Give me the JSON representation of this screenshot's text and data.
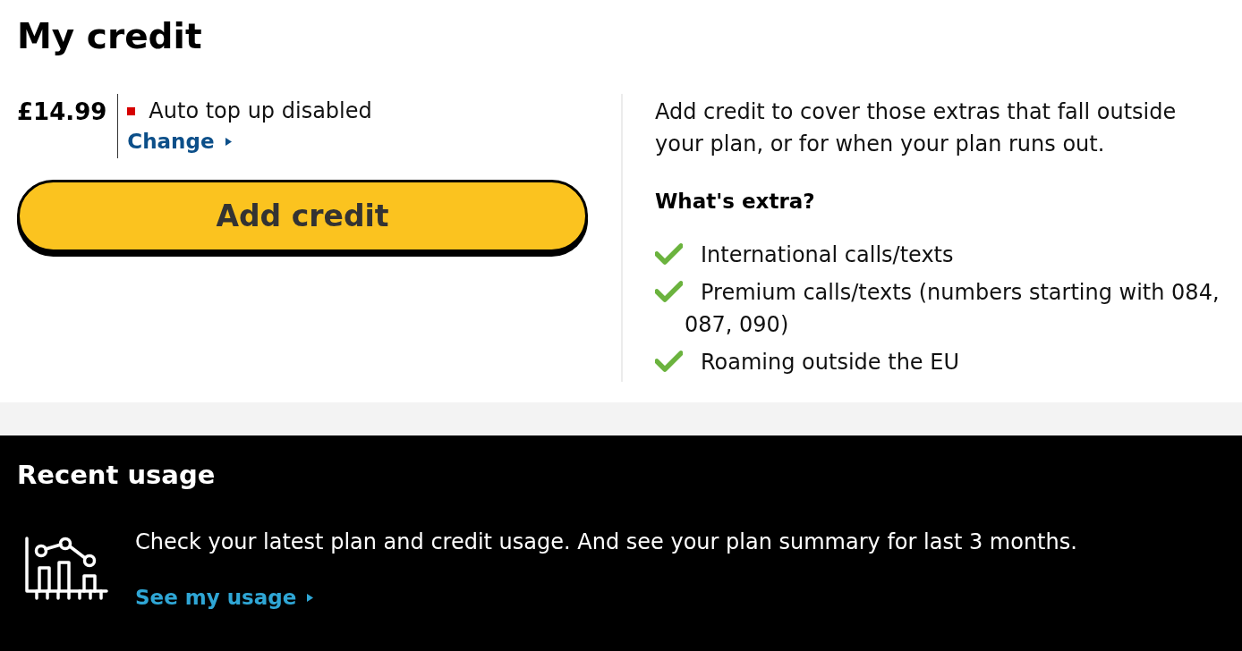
{
  "heading": "My credit",
  "balance": {
    "amount": "£14.99",
    "auto_top_up": {
      "label": "Auto top up disabled",
      "enabled": false
    },
    "change_link": "Change"
  },
  "add_credit_button": "Add credit",
  "extras": {
    "intro": "Add credit to cover those extras that fall outside your plan, or for when your plan runs out.",
    "heading": "What's extra?",
    "items": [
      "International calls/texts",
      "Premium calls/texts (numbers starting with 084, 087, 090)",
      "Roaming outside the EU"
    ]
  },
  "recent_usage": {
    "heading": "Recent usage",
    "description": "Check your latest plan and credit usage. And see your plan summary for last 3 months.",
    "link": "See my usage"
  }
}
